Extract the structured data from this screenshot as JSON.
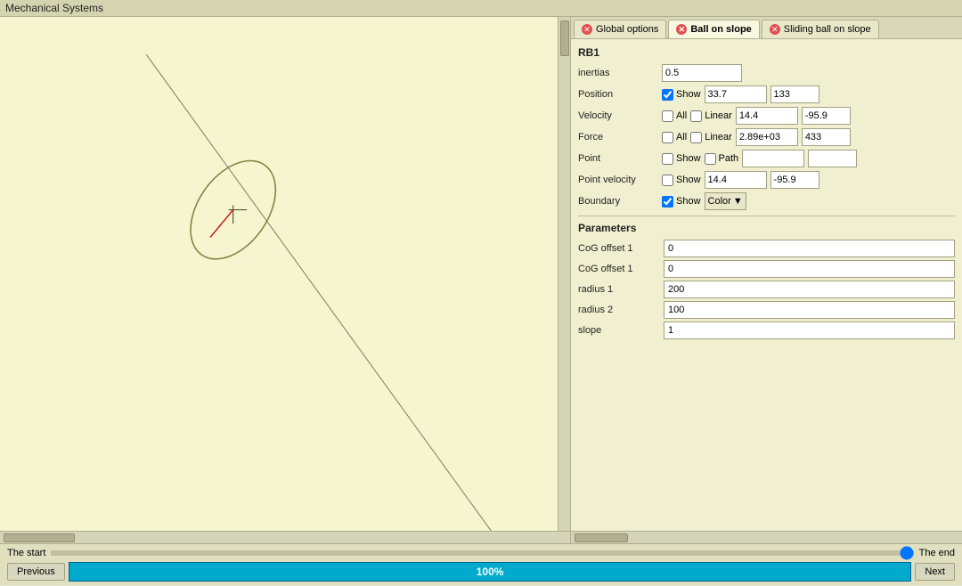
{
  "title_bar": {
    "label": "Mechanical Systems"
  },
  "tabs": [
    {
      "id": "global-options",
      "label": "Global options",
      "active": false
    },
    {
      "id": "ball-on-slope",
      "label": "Ball on slope",
      "active": true
    },
    {
      "id": "sliding-ball-on-slope",
      "label": "Sliding ball on slope",
      "active": false
    }
  ],
  "rb1": {
    "section_label": "RB1",
    "inertias_label": "inertias",
    "inertias_value": "0.5",
    "position_label": "Position",
    "position_show_checked": true,
    "position_show_label": "Show",
    "position_x": "33.7",
    "position_y": "133",
    "velocity_label": "Velocity",
    "velocity_all_checked": false,
    "velocity_all_label": "All",
    "velocity_linear_checked": false,
    "velocity_linear_label": "Linear",
    "velocity_x": "14.4",
    "velocity_y": "-95.9",
    "force_label": "Force",
    "force_all_checked": false,
    "force_all_label": "All",
    "force_linear_checked": false,
    "force_linear_label": "Linear",
    "force_x": "2.89e+03",
    "force_y": "433",
    "point_label": "Point",
    "point_show_checked": false,
    "point_show_label": "Show",
    "point_path_checked": false,
    "point_path_label": "Path",
    "point_x": "",
    "point_y": "",
    "point_velocity_label": "Point velocity",
    "point_velocity_show_checked": false,
    "point_velocity_show_label": "Show",
    "point_velocity_x": "14.4",
    "point_velocity_y": "-95.9",
    "boundary_label": "Boundary",
    "boundary_show_checked": true,
    "boundary_show_label": "Show",
    "boundary_color_label": "Color",
    "boundary_color_arrow": "▼"
  },
  "parameters": {
    "section_label": "Parameters",
    "cog_offset_1_label": "CoG offset 1",
    "cog_offset_1_value": "0",
    "cog_offset_2_label": "CoG offset 1",
    "cog_offset_2_value": "0",
    "radius_1_label": "radius 1",
    "radius_1_value": "200",
    "radius_2_label": "radius 2",
    "radius_2_value": "100",
    "slope_label": "slope",
    "slope_value": "1"
  },
  "bottom": {
    "start_label": "The start",
    "end_label": "The end",
    "previous_label": "Previous",
    "next_label": "Next",
    "progress_value": "100%"
  }
}
